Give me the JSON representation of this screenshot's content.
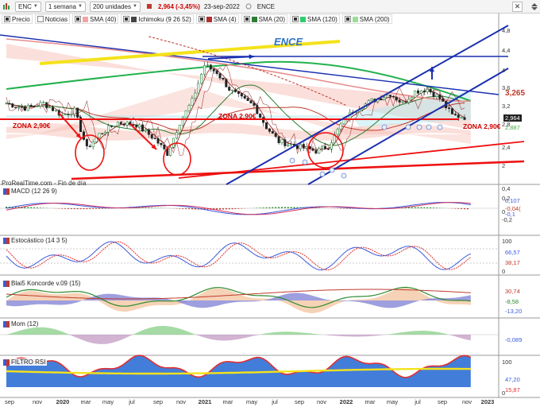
{
  "toolbar": {
    "symbol": "ENC",
    "timeframe": "1 semana",
    "units": "200 unidades",
    "price": "2,964 (-3,45%)",
    "date": "23-sep-2022",
    "name": "ENCE"
  },
  "legend": [
    {
      "label": "Precio",
      "checked": true,
      "color": ""
    },
    {
      "label": "Noticias",
      "checked": false,
      "color": ""
    },
    {
      "label": "SMA (40)",
      "checked": true,
      "color": "#f3a3a3"
    },
    {
      "label": "Ichimoku (9 26 52)",
      "checked": true,
      "color": "#444444"
    },
    {
      "label": "SMA (4)",
      "checked": true,
      "color": "#b03030"
    },
    {
      "label": "SMA (20)",
      "checked": true,
      "color": "#2e7d32"
    },
    {
      "label": "SMA (120)",
      "checked": true,
      "color": "#2ecc71"
    },
    {
      "label": "SMA (200)",
      "checked": true,
      "color": "#9bdc9b"
    }
  ],
  "main": {
    "source": "ProRealTime.com - Fin de día",
    "ence_label": "ENCE",
    "zone_left": "ZONA 2,90€",
    "zone_mid": "ZONA 2,90€",
    "zone_right": "ZONA 2,90€",
    "y_ticks": [
      "4,8",
      "4,4",
      "4",
      "3,6",
      "3,2",
      "2,8",
      "2,4",
      "2"
    ],
    "values": [
      {
        "text": "3,265",
        "color": "#c0392b"
      },
      {
        "text": "2,964",
        "color": "#ffffff",
        "bg": "#222222"
      },
      {
        "text": "2,887",
        "color": "#4aa84a"
      }
    ]
  },
  "panels": [
    {
      "key": "macd",
      "label": "MACD (12 26 9)",
      "y_ticks": [
        "0,4",
        "0,2",
        "0",
        "-0,2"
      ],
      "values": [
        "0,107",
        "-0,04(",
        "-0,1"
      ]
    },
    {
      "key": "stoch",
      "label": "Estocástico (14 3 5)",
      "y_ticks": [
        "100",
        "0"
      ],
      "values": [
        "66,57",
        "38,17"
      ]
    },
    {
      "key": "blaiz",
      "label": "Blai5 Koncorde v.09 (15)",
      "y_ticks": [],
      "values": [
        "30,74",
        "-8,58",
        "-13,20"
      ]
    },
    {
      "key": "mom",
      "label": "Mom (12)",
      "y_ticks": [],
      "values": [
        "-0,089"
      ]
    },
    {
      "key": "rsi",
      "label": "FILTRO RSI",
      "y_ticks": [
        "100",
        "0"
      ],
      "values": [
        "47,20",
        "15,87"
      ]
    }
  ],
  "x_axis": [
    "sep",
    "nov",
    "2020",
    "mar",
    "may",
    "jul",
    "sep",
    "nov",
    "2021",
    "mar",
    "may",
    "jul",
    "sep",
    "nov",
    "2022",
    "mar",
    "may",
    "jul",
    "sep",
    "nov",
    "2023"
  ]
}
